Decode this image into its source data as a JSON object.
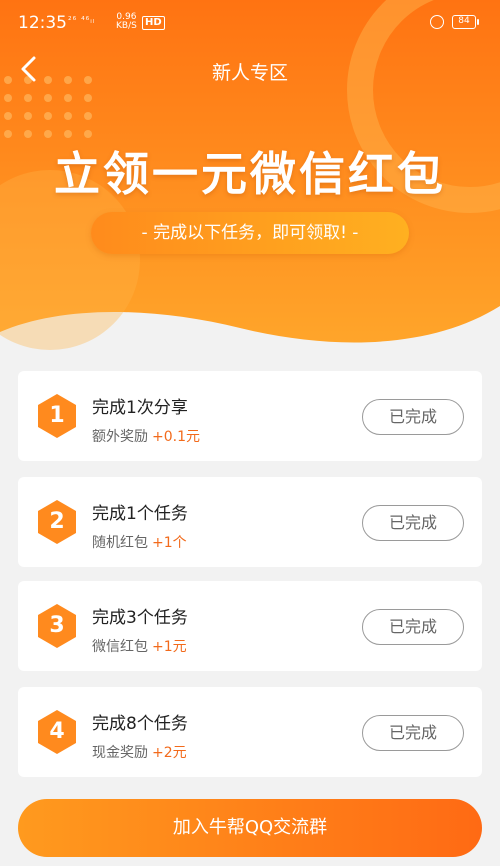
{
  "status": {
    "time": "12:35",
    "network": "²⁶ ⁴⁶ᵢₗ",
    "speed_value": "0.96",
    "speed_unit": "KB/S",
    "hd": "HD",
    "battery": "84"
  },
  "nav": {
    "back_icon": "chevron-left-icon",
    "title": "新人专区"
  },
  "hero": {
    "title": "立领一元微信红包",
    "subtitle": "- 完成以下任务，即可领取! -",
    "colors": {
      "top": "#ff7a12",
      "bottom": "#ffa62a"
    }
  },
  "tasks": [
    {
      "num": "1",
      "title": "完成1次分享",
      "reward_label": "额外奖励",
      "reward_amount": "+0.1元",
      "button": "已完成"
    },
    {
      "num": "2",
      "title": "完成1个任务",
      "reward_label": "随机红包",
      "reward_amount": "+1个",
      "button": "已完成"
    },
    {
      "num": "3",
      "title": "完成3个任务",
      "reward_label": "微信红包",
      "reward_amount": "+1元",
      "button": "已完成"
    },
    {
      "num": "4",
      "title": "完成8个任务",
      "reward_label": "现金奖励",
      "reward_amount": "+2元",
      "button": "已完成"
    }
  ],
  "join_button": "加入牛帮QQ交流群",
  "accent": "#ff8a1e"
}
